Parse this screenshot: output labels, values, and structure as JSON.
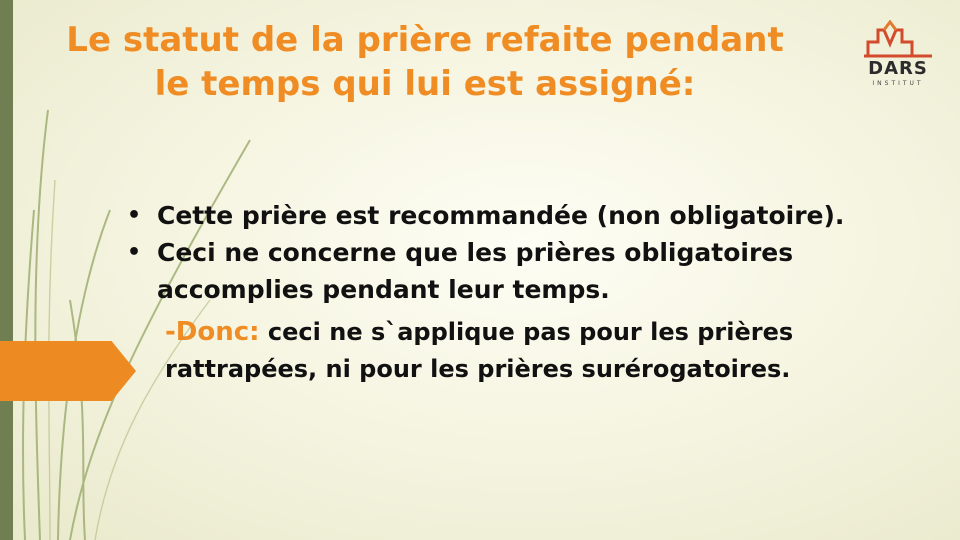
{
  "slide": {
    "title_line1": "Le statut de la prière refaite pendant",
    "title_line2": "le temps qui lui est assigné:",
    "bullets": [
      "Cette prière est recommandée (non obligatoire).",
      "Ceci ne concerne que les prières obligatoires accomplies pendant leur temps."
    ],
    "bullet_marker": "•",
    "note_keyword": "-Donc:",
    "note_text": " ceci ne s`applique pas pour les prières rattrapées, ni pour les prières surérogatoires."
  },
  "logo": {
    "word": "DARS",
    "subtitle": "INSTITUT"
  },
  "colors": {
    "accent": "#ef8c23",
    "sidebar": "#6f7f52",
    "text": "#111111"
  }
}
